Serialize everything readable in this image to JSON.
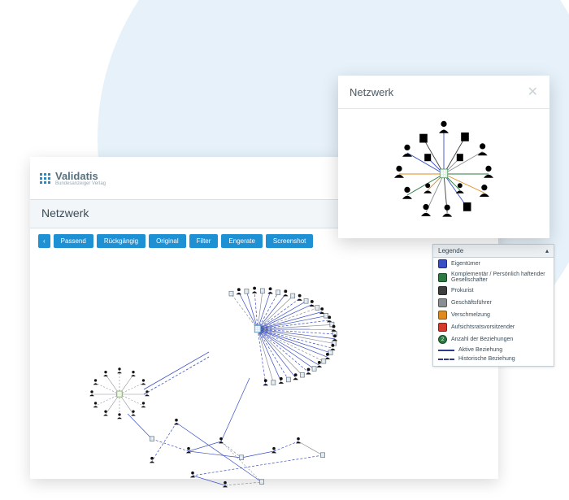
{
  "brand": {
    "name": "Validatis",
    "tagline": "Bundesanzeiger Verlag"
  },
  "app": {
    "section_title": "Netzwerk"
  },
  "toolbar": {
    "collapse_label": "‹",
    "fit_label": "Passend",
    "undo_label": "Rückgängig",
    "original_label": "Original",
    "filter_label": "Filter",
    "export_label": "Engerate",
    "screenshot_label": "Screenshot"
  },
  "legend": {
    "title": "Legende",
    "collapse_glyph": "▴",
    "items": [
      {
        "color": "#3a4fc4",
        "label": "Eigentümer"
      },
      {
        "color": "#2c7a42",
        "label": "Komplementär / Persönlich haftender Gesellschafter"
      },
      {
        "color": "#3e3e3e",
        "label": "Prokurist"
      },
      {
        "color": "#8a8f94",
        "label": "Geschäftsführer"
      },
      {
        "color": "#e08a1d",
        "label": "Verschmelzung"
      },
      {
        "color": "#d43b2a",
        "label": "Aufsichtsratsvorsitzender"
      }
    ],
    "count_label": "Anzahl der Beziehungen",
    "count_badge": "2",
    "active_label": "Aktive Beziehung",
    "historic_label": "Historische Beziehung"
  },
  "popup": {
    "title": "Netzwerk",
    "close_glyph": "✕"
  }
}
